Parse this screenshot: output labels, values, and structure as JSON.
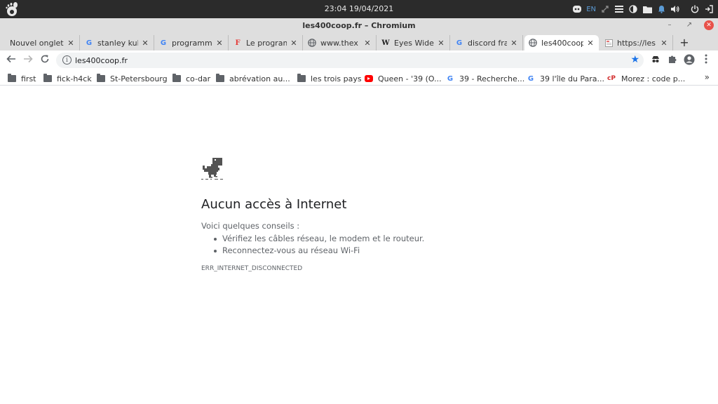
{
  "system_bar": {
    "clock": "23:04 19/04/2021",
    "keyboard_layout": "EN"
  },
  "window": {
    "title": "les400coop.fr – Chromium"
  },
  "tabs": [
    {
      "label": "Nouvel onglet",
      "icon": "none"
    },
    {
      "label": "stanley kub",
      "icon": "google-icon"
    },
    {
      "label": "programm",
      "icon": "google-icon"
    },
    {
      "label": "Le program",
      "icon": "red-f-icon"
    },
    {
      "label": "www.thex",
      "icon": "globe-icon"
    },
    {
      "label": "Eyes Wide",
      "icon": "wikipedia-icon"
    },
    {
      "label": "discord fra",
      "icon": "google-icon"
    },
    {
      "label": "les400coop",
      "icon": "globe-icon",
      "active": true
    },
    {
      "label": "https://les",
      "icon": "page-icon"
    }
  ],
  "toolbar": {
    "url": "les400coop.fr"
  },
  "bookmarks": [
    {
      "label": "first",
      "icon": "folder"
    },
    {
      "label": "fick-h4ck",
      "icon": "folder"
    },
    {
      "label": "St-Petersbourg",
      "icon": "folder"
    },
    {
      "label": "co-dar",
      "icon": "folder"
    },
    {
      "label": "abrévation au...",
      "icon": "folder"
    },
    {
      "label": "les trois pays",
      "icon": "folder"
    },
    {
      "label": "Queen - '39 (O...",
      "icon": "youtube"
    },
    {
      "label": "39 - Recherche...",
      "icon": "google"
    },
    {
      "label": "39 l'île du Para...",
      "icon": "google"
    },
    {
      "label": "Morez : code p...",
      "icon": "cp"
    }
  ],
  "bookmarks_more": "»",
  "error_page": {
    "title": "Aucun accès à Internet",
    "subtitle": "Voici quelques conseils :",
    "tips": [
      "Vérifiez les câbles réseau, le modem et le routeur.",
      "Reconnectez-vous au réseau Wi-Fi"
    ],
    "code": "ERR_INTERNET_DISCONNECTED"
  },
  "colors": {
    "system_bar": "#2b2b2b",
    "chrome_frame": "#dedede",
    "accent_blue": "#1a73e8",
    "text_secondary": "#5f6368"
  }
}
